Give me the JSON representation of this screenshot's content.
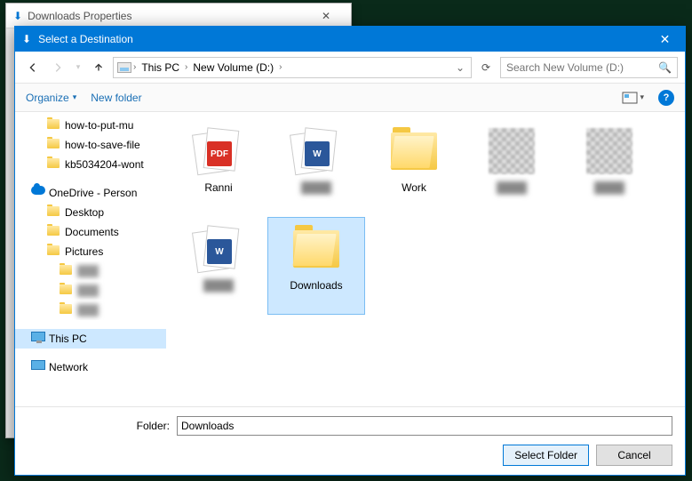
{
  "background_dialog": {
    "title": "Downloads Properties"
  },
  "dialog": {
    "title": "Select a Destination",
    "breadcrumb": {
      "root_icon": "drive",
      "items": [
        "This PC",
        "New Volume (D:)"
      ]
    },
    "search_placeholder": "Search New Volume (D:)",
    "toolbar": {
      "organize": "Organize",
      "new_folder": "New folder"
    },
    "sidebar": {
      "items": [
        {
          "label": "how-to-put-mu",
          "icon": "folder",
          "indent": 1
        },
        {
          "label": "how-to-save-file",
          "icon": "folder",
          "indent": 1
        },
        {
          "label": "kb5034204-wont",
          "icon": "folder",
          "indent": 1
        },
        {
          "label": "OneDrive - Person",
          "icon": "cloud",
          "indent": 0,
          "spaceBefore": true
        },
        {
          "label": "Desktop",
          "icon": "folder",
          "indent": 1
        },
        {
          "label": "Documents",
          "icon": "folder",
          "indent": 1
        },
        {
          "label": "Pictures",
          "icon": "folder",
          "indent": 1
        },
        {
          "label": "",
          "icon": "folder",
          "indent": 2,
          "blur": true
        },
        {
          "label": "",
          "icon": "folder",
          "indent": 2,
          "blur": true
        },
        {
          "label": "",
          "icon": "folder",
          "indent": 2,
          "blur": true
        },
        {
          "label": "This PC",
          "icon": "monitor",
          "indent": 0,
          "selected": true,
          "spaceBefore": true
        },
        {
          "label": "Network",
          "icon": "network",
          "indent": 0,
          "spaceBefore": true
        }
      ]
    },
    "content_items": [
      {
        "label": "Ranni",
        "type": "pdf-stack"
      },
      {
        "label": "",
        "type": "word-stack",
        "blurLabel": true
      },
      {
        "label": "Work",
        "type": "folder"
      },
      {
        "label": "",
        "type": "pix",
        "blurLabel": true
      },
      {
        "label": "",
        "type": "pix",
        "blurLabel": true
      },
      {
        "label": "",
        "type": "word-stack",
        "blurLabel": true
      },
      {
        "label": "Downloads",
        "type": "folder",
        "selected": true
      }
    ],
    "footer": {
      "folder_label": "Folder:",
      "folder_value": "Downloads",
      "select_btn": "Select Folder",
      "cancel_btn": "Cancel"
    }
  }
}
